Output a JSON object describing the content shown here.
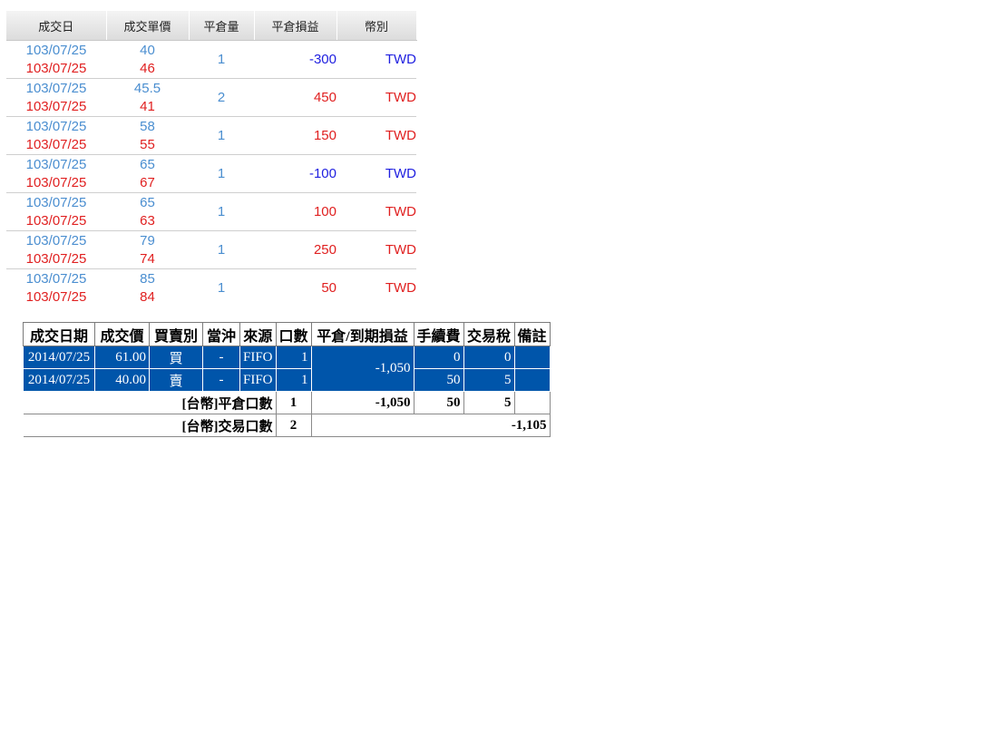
{
  "closed_positions": {
    "headers": [
      "成交日",
      "成交單價",
      "平倉量",
      "平倉損益",
      "幣別"
    ],
    "rows": [
      {
        "date_open": "103/07/25",
        "date_close": "103/07/25",
        "price_open": "40",
        "price_close": "46",
        "qty": "1",
        "pl": "-300",
        "currency": "TWD"
      },
      {
        "date_open": "103/07/25",
        "date_close": "103/07/25",
        "price_open": "45.5",
        "price_close": "41",
        "qty": "2",
        "pl": "450",
        "currency": "TWD"
      },
      {
        "date_open": "103/07/25",
        "date_close": "103/07/25",
        "price_open": "58",
        "price_close": "55",
        "qty": "1",
        "pl": "150",
        "currency": "TWD"
      },
      {
        "date_open": "103/07/25",
        "date_close": "103/07/25",
        "price_open": "65",
        "price_close": "67",
        "qty": "1",
        "pl": "-100",
        "currency": "TWD"
      },
      {
        "date_open": "103/07/25",
        "date_close": "103/07/25",
        "price_open": "65",
        "price_close": "63",
        "qty": "1",
        "pl": "100",
        "currency": "TWD"
      },
      {
        "date_open": "103/07/25",
        "date_close": "103/07/25",
        "price_open": "79",
        "price_close": "74",
        "qty": "1",
        "pl": "250",
        "currency": "TWD"
      },
      {
        "date_open": "103/07/25",
        "date_close": "103/07/25",
        "price_open": "85",
        "price_close": "84",
        "qty": "1",
        "pl": "50",
        "currency": "TWD"
      }
    ]
  },
  "detail": {
    "headers": [
      "成交日期",
      "成交價",
      "買賣別",
      "當沖",
      "來源",
      "口數",
      "平倉/到期損益",
      "手續費",
      "交易稅",
      "備註"
    ],
    "rows": [
      {
        "date": "2014/07/25",
        "price": "61.00",
        "side": "買",
        "daytrade": "-",
        "source": "FIFO",
        "qty": "1",
        "fee": "0",
        "tax": "0",
        "note": ""
      },
      {
        "date": "2014/07/25",
        "price": "40.00",
        "side": "賣",
        "daytrade": "-",
        "source": "FIFO",
        "qty": "1",
        "fee": "50",
        "tax": "5",
        "note": ""
      }
    ],
    "pl_merged": "-1,050",
    "summary_close": {
      "label": "[台幣]平倉口數",
      "qty": "1",
      "pl": "-1,050",
      "fee": "50",
      "tax": "5"
    },
    "summary_trade": {
      "label": "[台幣]交易口數",
      "qty": "2",
      "net": "-1,105"
    }
  }
}
